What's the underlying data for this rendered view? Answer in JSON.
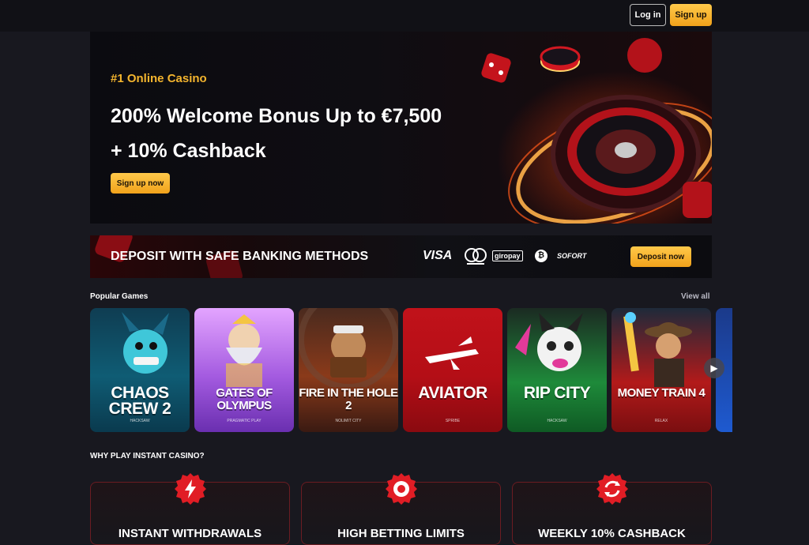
{
  "header": {
    "login_label": "Log in",
    "signup_label": "Sign up"
  },
  "hero": {
    "kicker": "#1 Online Casino",
    "title_line1": "200% Welcome Bonus Up to €7,500",
    "title_line2": "+ 10% Cashback",
    "cta_label": "Sign up now"
  },
  "banking": {
    "title": "DEPOSIT WITH SAFE BANKING METHODS",
    "methods": [
      "VISA",
      "mastercard",
      "giropay",
      "bitcoin",
      "SOFORT"
    ],
    "visa": "VISA",
    "giropay": "giropay",
    "sofort": "SOFORT",
    "cta_label": "Deposit now"
  },
  "popular": {
    "title": "Popular Games",
    "view_all": "View all",
    "games": [
      {
        "name": "CHAOS CREW 2",
        "provider": "HACKSAW"
      },
      {
        "name": "GATES OF OLYMPUS",
        "provider": "PRAGMATIC PLAY"
      },
      {
        "name": "FIRE IN THE HOLE 2",
        "provider": "NOLIMIT CITY"
      },
      {
        "name": "AVIATOR",
        "provider": "SPRIBE"
      },
      {
        "name": "RIP CITY",
        "provider": "HACKSAW"
      },
      {
        "name": "MONEY TRAIN 4",
        "provider": "RELAX"
      }
    ]
  },
  "why": {
    "title": "WHY PLAY INSTANT CASINO?",
    "cards": [
      {
        "title": "INSTANT WITHDRAWALS",
        "icon": "lightning-icon"
      },
      {
        "title": "HIGH BETTING LIMITS",
        "icon": "chip-icon"
      },
      {
        "title": "WEEKLY 10% CASHBACK",
        "icon": "refresh-icon"
      }
    ]
  },
  "colors": {
    "accent": "#f4b52e",
    "background": "#18181f",
    "card_border": "#6b1c22",
    "badge_red": "#e11d25"
  }
}
